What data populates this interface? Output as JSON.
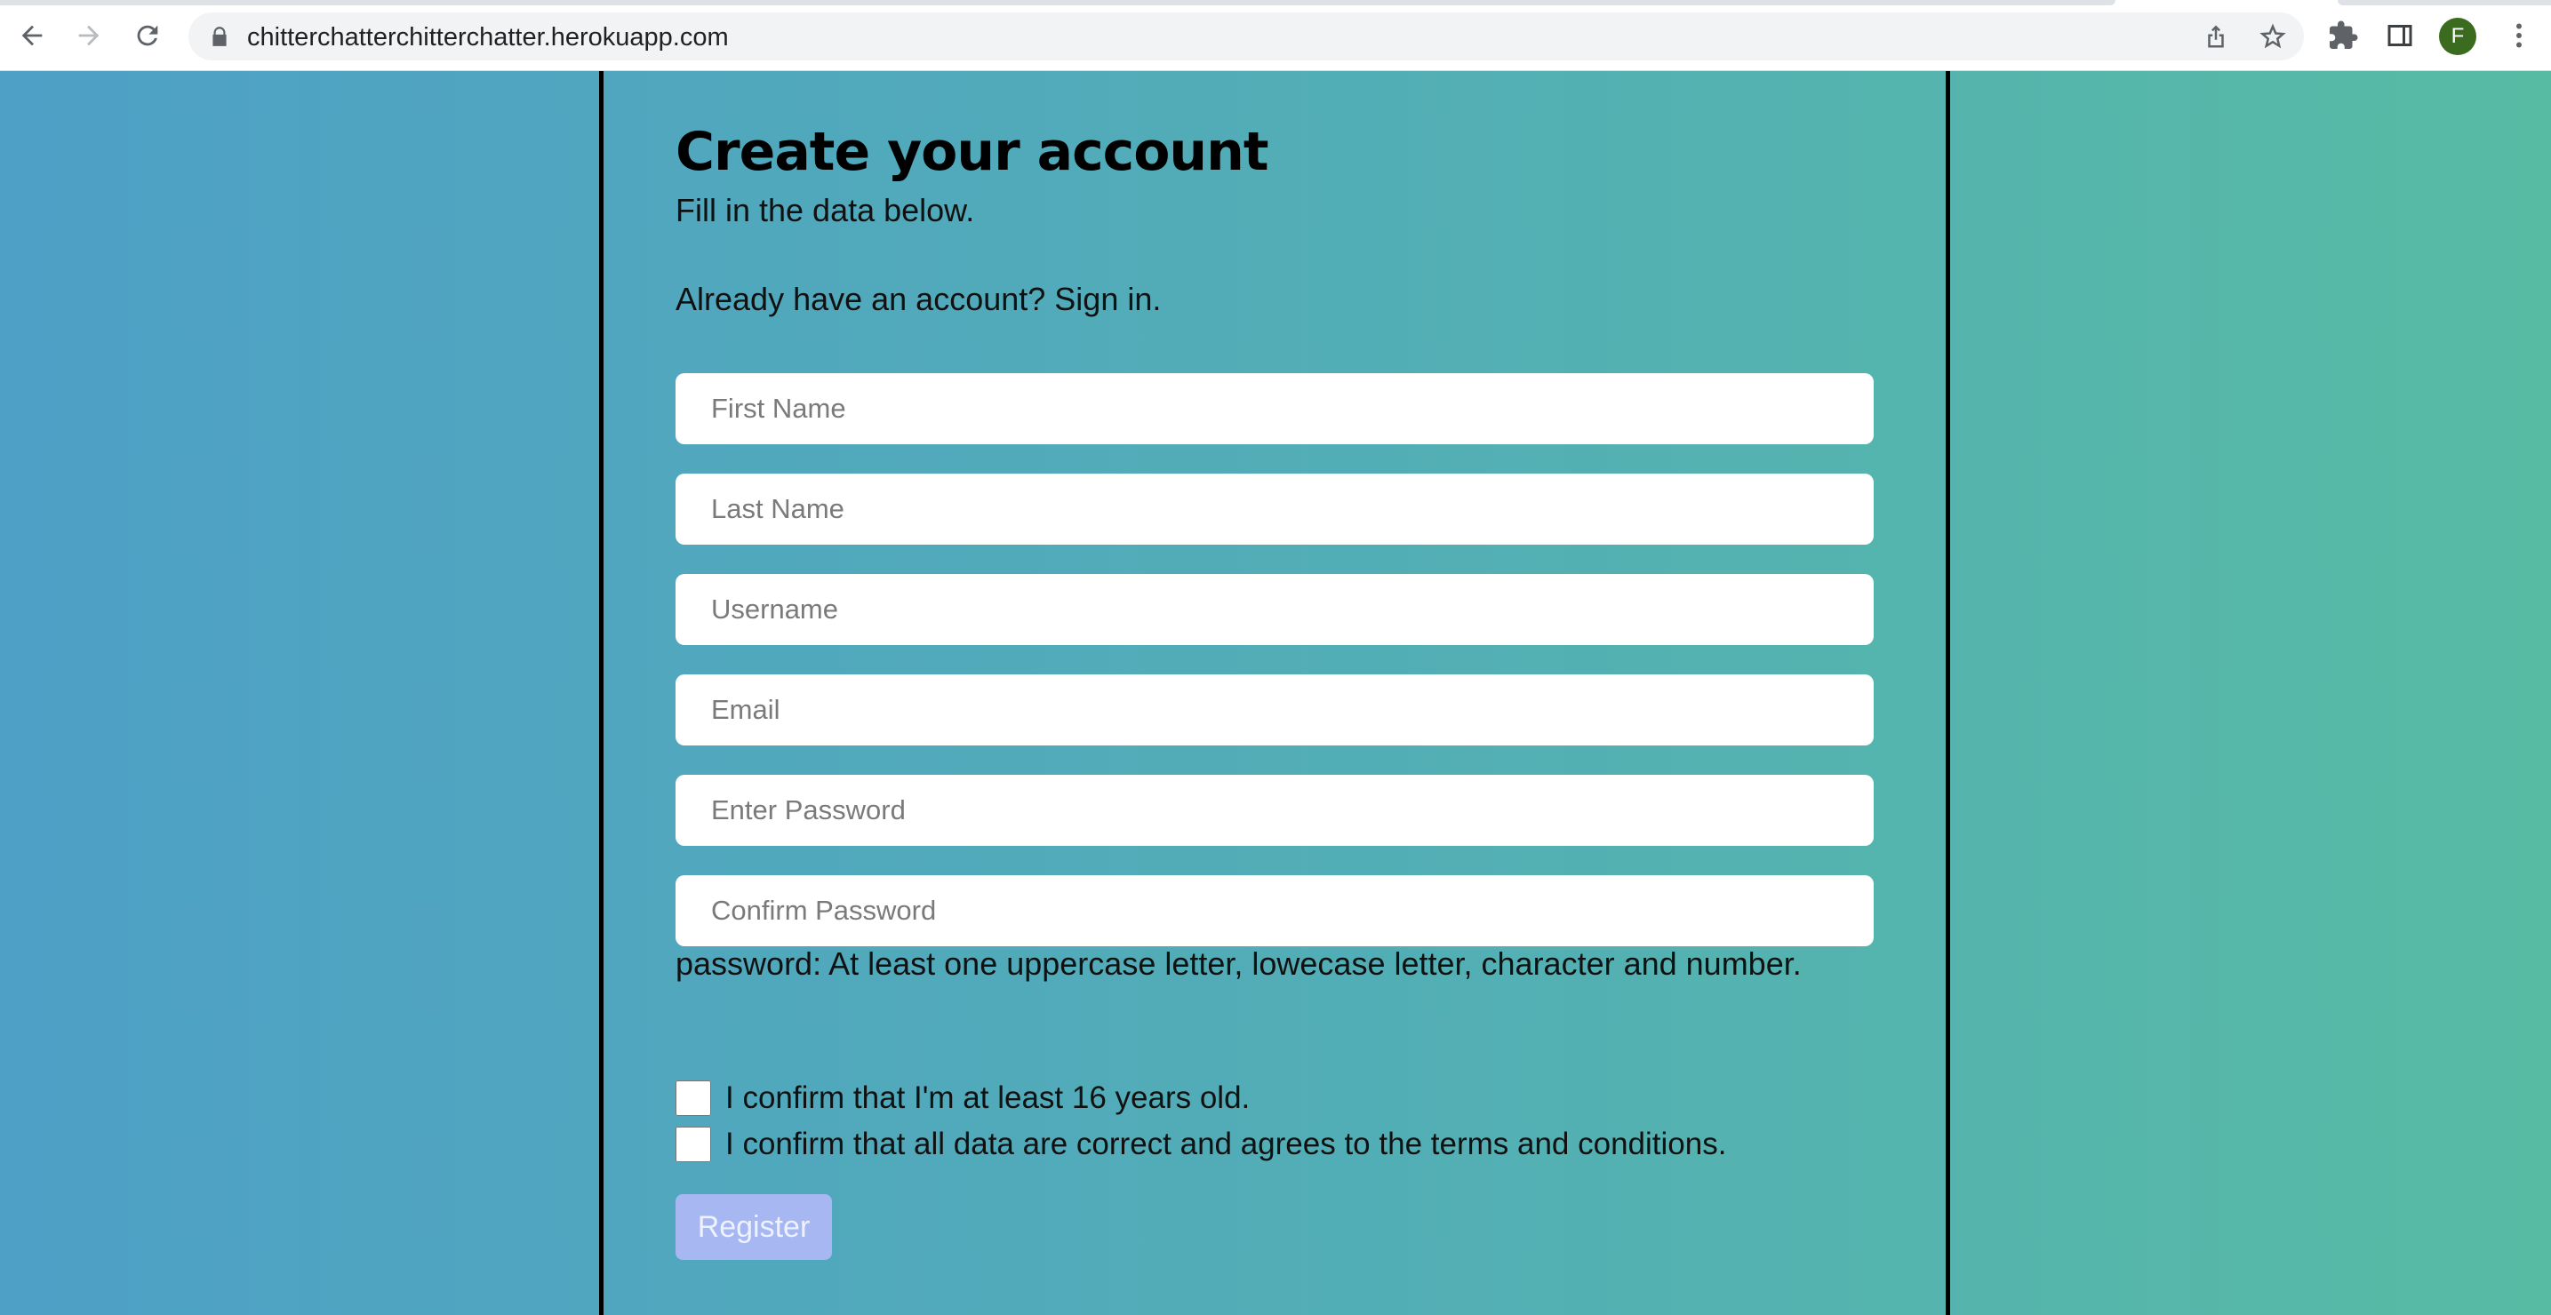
{
  "browser": {
    "url": "chitterchatterchitterchatter.herokuapp.com",
    "profile_initial": "F",
    "icons": [
      "back-arrow-icon",
      "forward-arrow-icon",
      "reload-icon",
      "lock-icon",
      "share-icon",
      "star-icon",
      "extensions-puzzle-icon",
      "side-panel-icon",
      "more-vert-icon"
    ]
  },
  "page": {
    "title": "Create your account",
    "subtitle": "Fill in the data below.",
    "signin_text": "Already have an account? Sign in.",
    "fields": {
      "first_name": {
        "placeholder": "First Name",
        "value": ""
      },
      "last_name": {
        "placeholder": "Last Name",
        "value": ""
      },
      "username": {
        "placeholder": "Username",
        "value": ""
      },
      "email": {
        "placeholder": "Email",
        "value": ""
      },
      "password": {
        "placeholder": "Enter Password",
        "value": ""
      },
      "confirm_password": {
        "placeholder": "Confirm Password",
        "value": ""
      }
    },
    "password_hint": "password: At least one uppercase letter, lowecase letter, character and number.",
    "checkboxes": {
      "age": {
        "label": "I confirm that I'm at least 16 years old.",
        "checked": false
      },
      "terms": {
        "label": "I confirm that all data are correct and agrees to the terms and conditions.",
        "checked": false
      }
    },
    "register_label": "Register"
  },
  "colors": {
    "background_left": "#4ea0c6",
    "background_right": "#57bba4",
    "register_button": "#a6b7f2",
    "avatar": "#3b6b1e"
  }
}
